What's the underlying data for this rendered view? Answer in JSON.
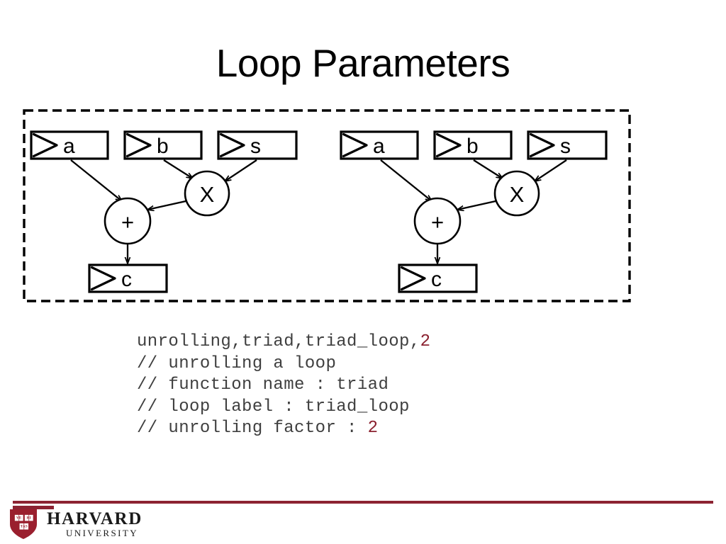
{
  "slide": {
    "title": "Loop Parameters"
  },
  "diagram": {
    "name": "unrolled-dataflow-graph",
    "border_style": "dashed",
    "border_color": "#000000",
    "groups": [
      {
        "name": "iteration-1",
        "inputs": [
          {
            "label": "a",
            "name": "input-port-a"
          },
          {
            "label": "b",
            "name": "input-port-b"
          },
          {
            "label": "s",
            "name": "input-port-s"
          }
        ],
        "operators": [
          {
            "label": "X",
            "name": "multiply-node"
          },
          {
            "label": "+",
            "name": "add-node"
          }
        ],
        "outputs": [
          {
            "label": "c",
            "name": "output-port-c"
          }
        ],
        "edges": [
          {
            "from": "a",
            "to": "+"
          },
          {
            "from": "b",
            "to": "X"
          },
          {
            "from": "s",
            "to": "X"
          },
          {
            "from": "X",
            "to": "+"
          },
          {
            "from": "+",
            "to": "c"
          }
        ]
      },
      {
        "name": "iteration-2",
        "inputs": [
          {
            "label": "a",
            "name": "input-port-a"
          },
          {
            "label": "b",
            "name": "input-port-b"
          },
          {
            "label": "s",
            "name": "input-port-s"
          }
        ],
        "operators": [
          {
            "label": "X",
            "name": "multiply-node"
          },
          {
            "label": "+",
            "name": "add-node"
          }
        ],
        "outputs": [
          {
            "label": "c",
            "name": "output-port-c"
          }
        ],
        "edges": [
          {
            "from": "a",
            "to": "+"
          },
          {
            "from": "b",
            "to": "X"
          },
          {
            "from": "s",
            "to": "X"
          },
          {
            "from": "X",
            "to": "+"
          },
          {
            "from": "+",
            "to": "c"
          }
        ]
      }
    ]
  },
  "code": {
    "lines": [
      [
        {
          "text": "unrolling,triad,triad_loop,",
          "type": "plain"
        },
        {
          "text": "2",
          "type": "number"
        }
      ],
      [
        {
          "text": "// unrolling a loop",
          "type": "plain"
        }
      ],
      [
        {
          "text": "// function name : triad",
          "type": "plain"
        }
      ],
      [
        {
          "text": "// loop label : triad_loop",
          "type": "plain"
        }
      ],
      [
        {
          "text": "// unrolling factor : ",
          "type": "plain"
        },
        {
          "text": "2",
          "type": "number"
        }
      ]
    ],
    "text_color": "#3f3f3f",
    "number_color": "#8b2230"
  },
  "footer": {
    "rule_color": "#8c2332",
    "logo": {
      "shield_color": "#9a1f2e",
      "books": [
        "VE",
        "RI",
        "TAS"
      ],
      "wordmark": "HARVARD",
      "subtitle": "UNIVERSITY"
    }
  }
}
